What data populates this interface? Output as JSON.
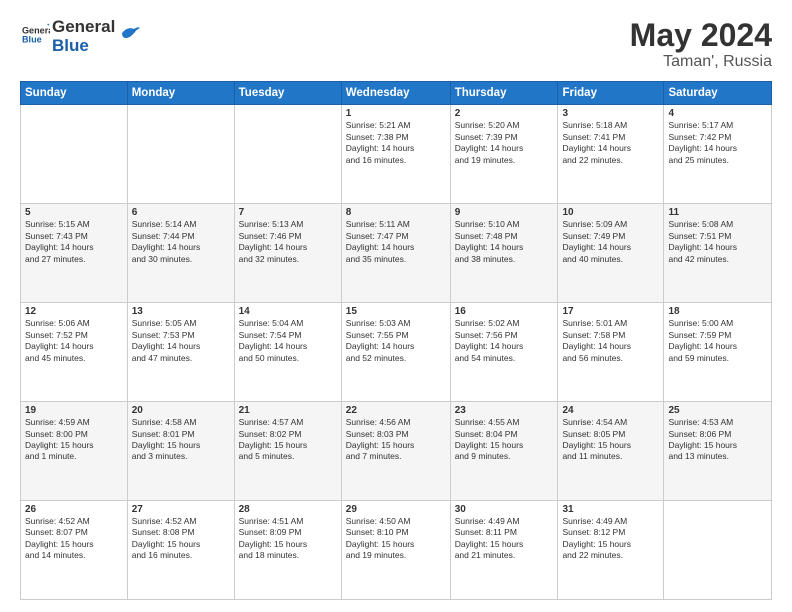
{
  "logo": {
    "general": "General",
    "blue": "Blue"
  },
  "title": {
    "month": "May 2024",
    "location": "Taman', Russia"
  },
  "headers": [
    "Sunday",
    "Monday",
    "Tuesday",
    "Wednesday",
    "Thursday",
    "Friday",
    "Saturday"
  ],
  "weeks": [
    [
      {
        "day": "",
        "info": ""
      },
      {
        "day": "",
        "info": ""
      },
      {
        "day": "",
        "info": ""
      },
      {
        "day": "1",
        "info": "Sunrise: 5:21 AM\nSunset: 7:38 PM\nDaylight: 14 hours\nand 16 minutes."
      },
      {
        "day": "2",
        "info": "Sunrise: 5:20 AM\nSunset: 7:39 PM\nDaylight: 14 hours\nand 19 minutes."
      },
      {
        "day": "3",
        "info": "Sunrise: 5:18 AM\nSunset: 7:41 PM\nDaylight: 14 hours\nand 22 minutes."
      },
      {
        "day": "4",
        "info": "Sunrise: 5:17 AM\nSunset: 7:42 PM\nDaylight: 14 hours\nand 25 minutes."
      }
    ],
    [
      {
        "day": "5",
        "info": "Sunrise: 5:15 AM\nSunset: 7:43 PM\nDaylight: 14 hours\nand 27 minutes."
      },
      {
        "day": "6",
        "info": "Sunrise: 5:14 AM\nSunset: 7:44 PM\nDaylight: 14 hours\nand 30 minutes."
      },
      {
        "day": "7",
        "info": "Sunrise: 5:13 AM\nSunset: 7:46 PM\nDaylight: 14 hours\nand 32 minutes."
      },
      {
        "day": "8",
        "info": "Sunrise: 5:11 AM\nSunset: 7:47 PM\nDaylight: 14 hours\nand 35 minutes."
      },
      {
        "day": "9",
        "info": "Sunrise: 5:10 AM\nSunset: 7:48 PM\nDaylight: 14 hours\nand 38 minutes."
      },
      {
        "day": "10",
        "info": "Sunrise: 5:09 AM\nSunset: 7:49 PM\nDaylight: 14 hours\nand 40 minutes."
      },
      {
        "day": "11",
        "info": "Sunrise: 5:08 AM\nSunset: 7:51 PM\nDaylight: 14 hours\nand 42 minutes."
      }
    ],
    [
      {
        "day": "12",
        "info": "Sunrise: 5:06 AM\nSunset: 7:52 PM\nDaylight: 14 hours\nand 45 minutes."
      },
      {
        "day": "13",
        "info": "Sunrise: 5:05 AM\nSunset: 7:53 PM\nDaylight: 14 hours\nand 47 minutes."
      },
      {
        "day": "14",
        "info": "Sunrise: 5:04 AM\nSunset: 7:54 PM\nDaylight: 14 hours\nand 50 minutes."
      },
      {
        "day": "15",
        "info": "Sunrise: 5:03 AM\nSunset: 7:55 PM\nDaylight: 14 hours\nand 52 minutes."
      },
      {
        "day": "16",
        "info": "Sunrise: 5:02 AM\nSunset: 7:56 PM\nDaylight: 14 hours\nand 54 minutes."
      },
      {
        "day": "17",
        "info": "Sunrise: 5:01 AM\nSunset: 7:58 PM\nDaylight: 14 hours\nand 56 minutes."
      },
      {
        "day": "18",
        "info": "Sunrise: 5:00 AM\nSunset: 7:59 PM\nDaylight: 14 hours\nand 59 minutes."
      }
    ],
    [
      {
        "day": "19",
        "info": "Sunrise: 4:59 AM\nSunset: 8:00 PM\nDaylight: 15 hours\nand 1 minute."
      },
      {
        "day": "20",
        "info": "Sunrise: 4:58 AM\nSunset: 8:01 PM\nDaylight: 15 hours\nand 3 minutes."
      },
      {
        "day": "21",
        "info": "Sunrise: 4:57 AM\nSunset: 8:02 PM\nDaylight: 15 hours\nand 5 minutes."
      },
      {
        "day": "22",
        "info": "Sunrise: 4:56 AM\nSunset: 8:03 PM\nDaylight: 15 hours\nand 7 minutes."
      },
      {
        "day": "23",
        "info": "Sunrise: 4:55 AM\nSunset: 8:04 PM\nDaylight: 15 hours\nand 9 minutes."
      },
      {
        "day": "24",
        "info": "Sunrise: 4:54 AM\nSunset: 8:05 PM\nDaylight: 15 hours\nand 11 minutes."
      },
      {
        "day": "25",
        "info": "Sunrise: 4:53 AM\nSunset: 8:06 PM\nDaylight: 15 hours\nand 13 minutes."
      }
    ],
    [
      {
        "day": "26",
        "info": "Sunrise: 4:52 AM\nSunset: 8:07 PM\nDaylight: 15 hours\nand 14 minutes."
      },
      {
        "day": "27",
        "info": "Sunrise: 4:52 AM\nSunset: 8:08 PM\nDaylight: 15 hours\nand 16 minutes."
      },
      {
        "day": "28",
        "info": "Sunrise: 4:51 AM\nSunset: 8:09 PM\nDaylight: 15 hours\nand 18 minutes."
      },
      {
        "day": "29",
        "info": "Sunrise: 4:50 AM\nSunset: 8:10 PM\nDaylight: 15 hours\nand 19 minutes."
      },
      {
        "day": "30",
        "info": "Sunrise: 4:49 AM\nSunset: 8:11 PM\nDaylight: 15 hours\nand 21 minutes."
      },
      {
        "day": "31",
        "info": "Sunrise: 4:49 AM\nSunset: 8:12 PM\nDaylight: 15 hours\nand 22 minutes."
      },
      {
        "day": "",
        "info": ""
      }
    ]
  ]
}
